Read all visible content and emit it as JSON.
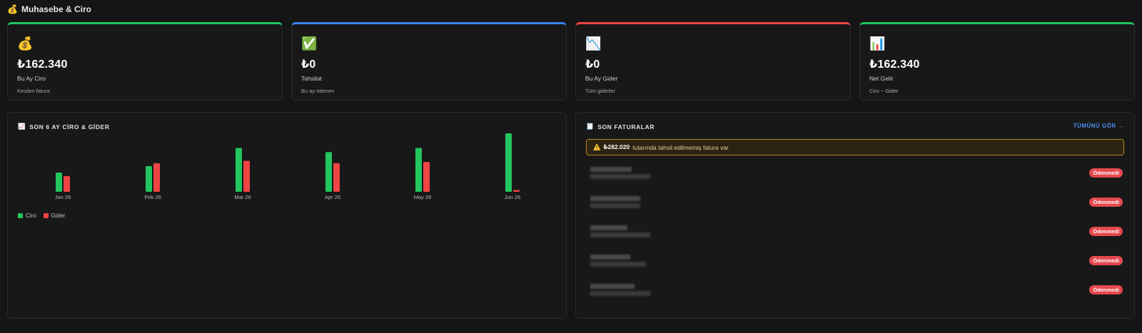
{
  "page": {
    "title": "Muhasebe & Ciro",
    "title_icon": "money-bag-icon"
  },
  "stats": [
    {
      "icon": "💰",
      "icon_name": "money-bag-icon",
      "value": "₺162.340",
      "label": "Bu Ay Ciro",
      "sub": "Kesilen fatura",
      "accent": "#22c55e"
    },
    {
      "icon": "✅",
      "icon_name": "check-icon",
      "value": "₺0",
      "label": "Tahsilat",
      "sub": "Bu ay ödenen",
      "accent": "#3b82f6"
    },
    {
      "icon": "📉",
      "icon_name": "chart-down-icon",
      "value": "₺0",
      "label": "Bu Ay Gider",
      "sub": "Tüm giderler",
      "accent": "#ef4444"
    },
    {
      "icon": "📊",
      "icon_name": "bar-chart-icon",
      "value": "₺162.340",
      "label": "Net Gelir",
      "sub": "Ciro − Gider",
      "accent": "#22c55e"
    }
  ],
  "chart_panel": {
    "icon": "📈",
    "title": "SON 6 AY CİRO & GİDER"
  },
  "chart_data": {
    "type": "bar",
    "categories": [
      "Jan 26",
      "Feb 26",
      "Mar 26",
      "Apr 26",
      "May 26",
      "Jun 26"
    ],
    "series": [
      {
        "name": "Ciro",
        "color": "#22c55e",
        "values": [
          33,
          44,
          75,
          68,
          75,
          100
        ]
      },
      {
        "name": "Gider",
        "color": "#ef4444",
        "values": [
          27,
          49,
          53,
          49,
          51,
          3
        ]
      }
    ],
    "ylim": [
      0,
      100
    ],
    "grid": false,
    "legend": "bottom-left"
  },
  "invoices_panel": {
    "icon": "🧾",
    "title": "SON FATURALAR",
    "see_all": "TÜMÜNÜ GÖR →",
    "alert_icon": "⚠️",
    "alert_amount": "₺282.020",
    "alert_text": "tutarında tahsil edilmemiş fatura var",
    "invoices": [
      {
        "status": "Ödenmedi"
      },
      {
        "status": "Ödenmedi"
      },
      {
        "status": "Ödenmedi"
      },
      {
        "status": "Ödenmedi"
      },
      {
        "status": "Ödenmedi"
      }
    ]
  },
  "colors": {
    "background": "#151515",
    "card": "#181818",
    "green": "#22c55e",
    "blue": "#3b82f6",
    "red": "#ef4444",
    "link": "#4f8ff0",
    "warning_border": "#b8871e"
  }
}
